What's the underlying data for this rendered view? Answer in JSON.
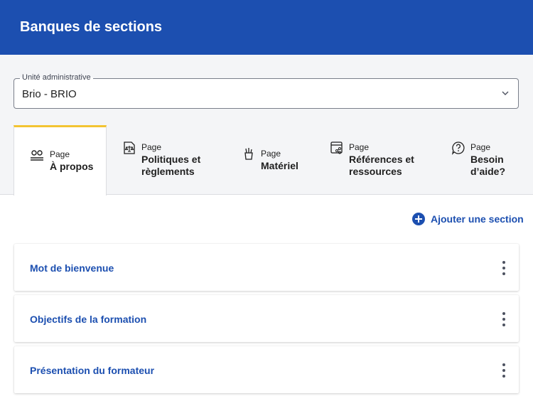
{
  "header": {
    "title": "Banques de sections"
  },
  "unit_select": {
    "label": "Unité administrative",
    "value": "Brio - BRIO"
  },
  "tabs": [
    {
      "prefix": "Page",
      "name": "À propos",
      "icon": "people-icon",
      "active": true
    },
    {
      "prefix": "Page",
      "name": "Politiques et règlements",
      "icon": "scale-document-icon",
      "active": false
    },
    {
      "prefix": "Page",
      "name": "Matériel",
      "icon": "supplies-cup-icon",
      "active": false
    },
    {
      "prefix": "Page",
      "name": "Références et ressources",
      "icon": "browser-share-icon",
      "active": false
    },
    {
      "prefix": "Page",
      "name": "Besoin d’aide?",
      "icon": "help-bubble-icon",
      "active": false
    }
  ],
  "actions": {
    "add_section": "Ajouter une section"
  },
  "sections": [
    {
      "title": "Mot de bienvenue"
    },
    {
      "title": "Objectifs de la formation"
    },
    {
      "title": "Présentation du formateur"
    }
  ],
  "colors": {
    "brand": "#1c4fb0",
    "active_tab_accent": "#f3c432",
    "panel_bg": "#f4f5f7"
  }
}
